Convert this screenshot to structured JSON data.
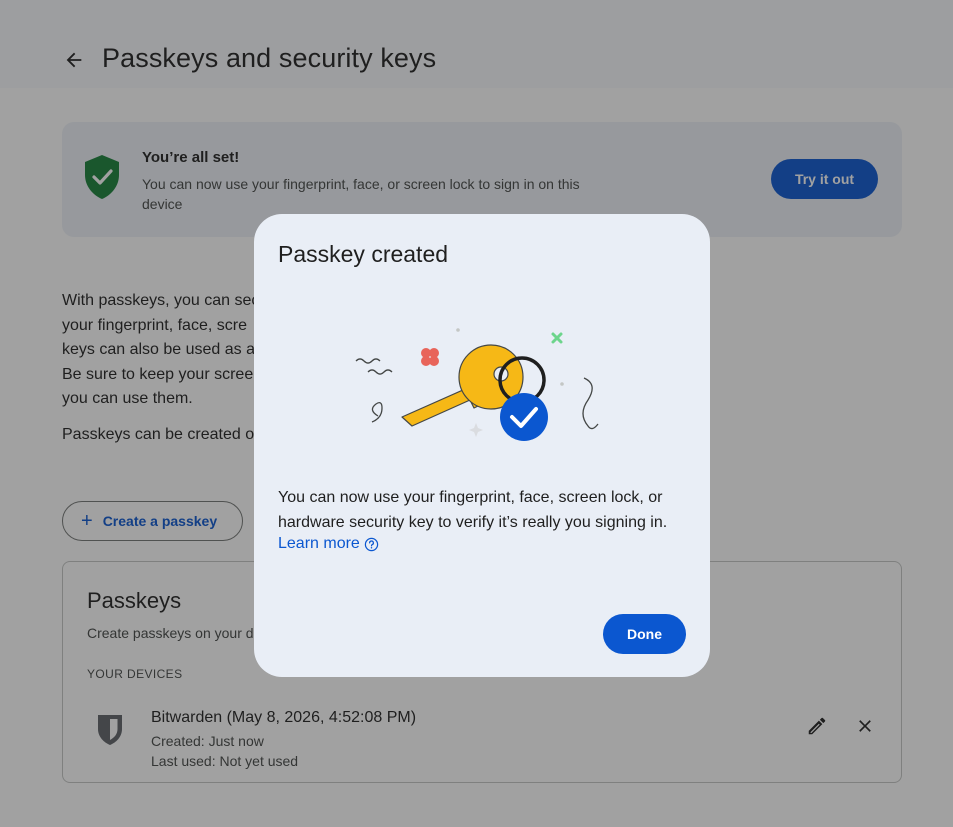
{
  "header": {
    "title": "Passkeys and security keys"
  },
  "banner": {
    "title": "You’re all set!",
    "text": "You can now use your fingerprint, face, or screen lock to sign in on this device",
    "button_label": "Try it out"
  },
  "intro": {
    "lines": [
      "With passkeys, you can sec",
      "your fingerprint, face, scre",
      "keys can also be used as a",
      "Be sure to keep your scree",
      "you can use them."
    ],
    "second": "Passkeys can be created o"
  },
  "create_button": {
    "label": "Create a passkey"
  },
  "passkeys_card": {
    "title": "Passkeys",
    "subtitle": "Create passkeys on your d",
    "devices_label": "YOUR DEVICES",
    "device": {
      "name": "Bitwarden (May 8, 2026, 4:52:08 PM)",
      "created": "Created: Just now",
      "last_used": "Last used: Not yet used"
    }
  },
  "dialog": {
    "title": "Passkey created",
    "text": "You can now use your fingerprint, face, screen lock, or hardware security key to verify it’s really you signing in.",
    "learn_more": "Learn more",
    "done_label": "Done"
  },
  "icons": {
    "back": "arrow-left-icon",
    "banner": "shield-check-icon",
    "device": "bitwarden-shield-icon",
    "edit": "pencil-icon",
    "delete": "close-icon",
    "help": "help-circle-icon"
  },
  "colors": {
    "accent": "#0b57d0",
    "success": "#188038",
    "key": "#f6b816",
    "scrim": "rgba(31,31,31,0.42)"
  }
}
